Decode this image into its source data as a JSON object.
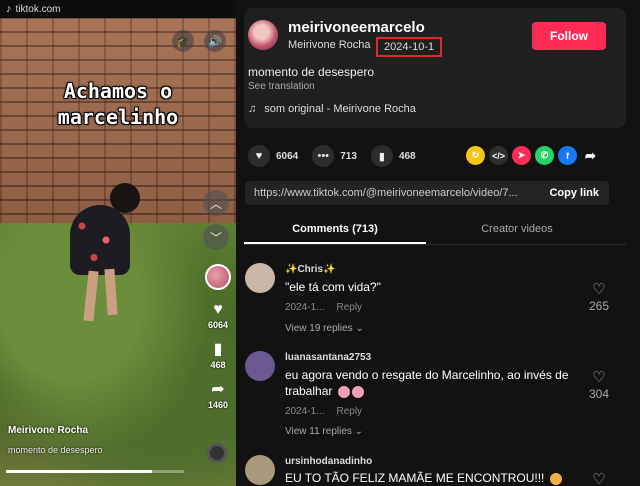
{
  "browser": {
    "site": "tiktok.com"
  },
  "video": {
    "overlay_line1": "Achamos o",
    "overlay_line2": "marcelinho",
    "likes": "6064",
    "comments": "468",
    "shares": "1460",
    "author": "Meirivone Rocha",
    "caption": "momento de desespero",
    "progress_fraction": 0.82
  },
  "post": {
    "handle": "meirivoneemarcelo",
    "display_name": "Meirivone Rocha",
    "date": "2024-10-1",
    "follow_label": "Follow",
    "description": "momento de desespero",
    "translate_label": "See translation",
    "sound": "som original - Meirivone Rocha"
  },
  "stats": {
    "likes": "6064",
    "comments": "713",
    "saves": "468"
  },
  "share_icons": [
    {
      "name": "repost-icon",
      "color": "#f5c518",
      "glyph": "↻"
    },
    {
      "name": "embed-icon",
      "color": "#2f2f2f",
      "glyph": "</>"
    },
    {
      "name": "send-icon",
      "color": "#fe2c55",
      "glyph": "➤"
    },
    {
      "name": "whatsapp-icon",
      "color": "#25d366",
      "glyph": "✆"
    },
    {
      "name": "facebook-icon",
      "color": "#1877f2",
      "glyph": "f"
    },
    {
      "name": "share-arrow-icon",
      "color": "#121212",
      "glyph": "➦"
    }
  ],
  "link": {
    "url": "https://www.tiktok.com/@meirivoneemarcelo/video/7...",
    "copy_label": "Copy link"
  },
  "tabs": [
    {
      "label": "Comments (713)",
      "active": true
    },
    {
      "label": "Creator videos",
      "active": false
    }
  ],
  "comments": [
    {
      "user": "✨Chris✨",
      "text": "\"ele tá com vida?\"",
      "date": "2024-1...",
      "reply_label": "Reply",
      "view_replies": "View 19 replies ⌄",
      "likes": "265",
      "avatar_color": "#c9b8a8"
    },
    {
      "user": "luanasantana2753",
      "text": "eu agora vendo o resgate do Marcelinho, ao invés de trabalhar",
      "date": "2024-1...",
      "reply_label": "Reply",
      "view_replies": "View 11 replies ⌄",
      "likes": "304",
      "avatar_color": "#6b5a8f"
    },
    {
      "user": "ursinhodanadinho",
      "text": "EU TO TÃO FELIZ MAMÃE ME ENCONTROU!!!",
      "likes": "",
      "avatar_color": "#a89a7a"
    }
  ]
}
